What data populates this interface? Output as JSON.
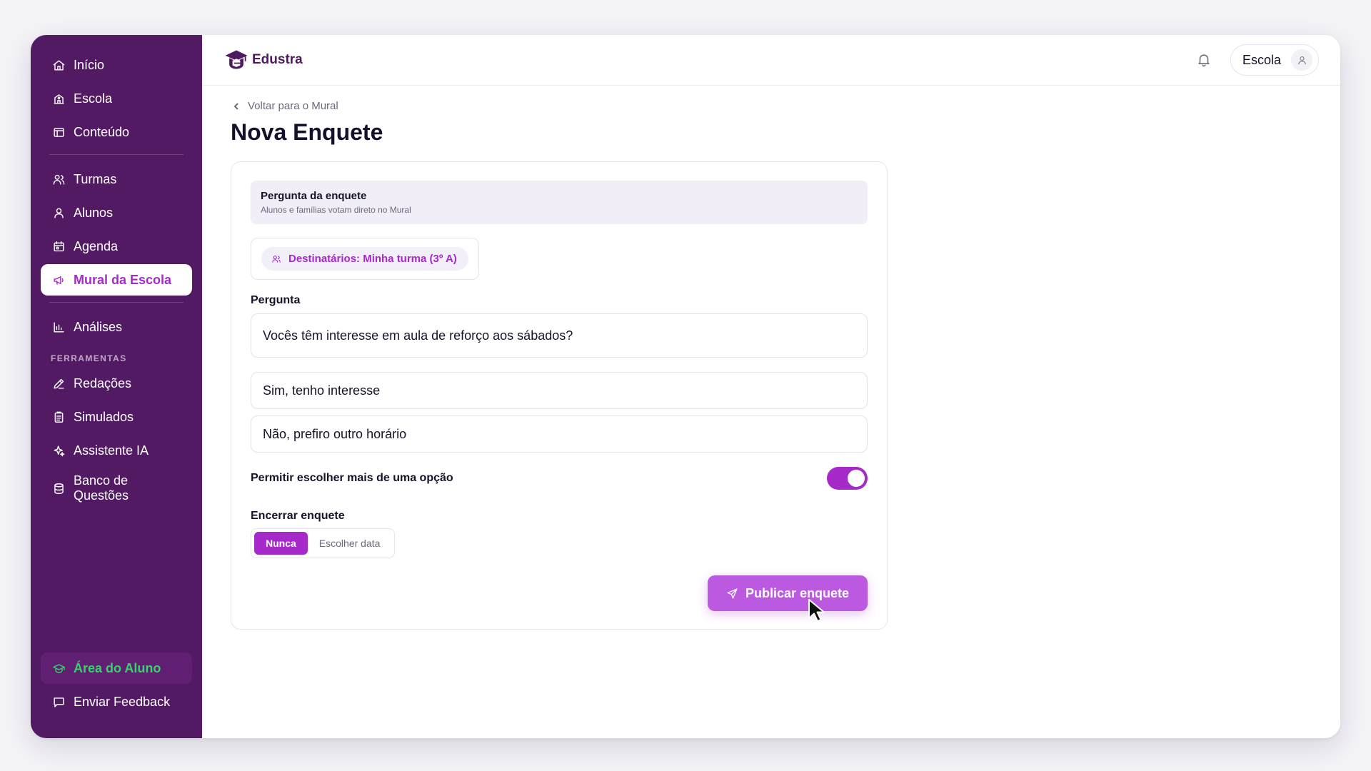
{
  "sidebar": {
    "items": [
      {
        "label": "Início",
        "icon": "home-icon"
      },
      {
        "label": "Escola",
        "icon": "school-icon"
      },
      {
        "label": "Conteúdo",
        "icon": "content-icon"
      },
      {
        "label": "Turmas",
        "icon": "users-icon"
      },
      {
        "label": "Alunos",
        "icon": "user-icon"
      },
      {
        "label": "Agenda",
        "icon": "calendar-icon"
      },
      {
        "label": "Mural da Escola",
        "icon": "megaphone-icon",
        "active": true
      },
      {
        "label": "Análises",
        "icon": "bar-chart-icon"
      }
    ],
    "tools_label": "FERRAMENTAS",
    "tools": [
      {
        "label": "Redações",
        "icon": "pen-icon"
      },
      {
        "label": "Simulados",
        "icon": "clipboard-icon"
      },
      {
        "label": "Assistente IA",
        "icon": "sparkles-icon"
      },
      {
        "label": "Banco de Questões",
        "icon": "database-icon"
      }
    ],
    "bottom": [
      {
        "label": "Área do Aluno",
        "icon": "graduation-cap-icon"
      },
      {
        "label": "Enviar Feedback",
        "icon": "message-icon"
      }
    ]
  },
  "header": {
    "brand": "Edustra",
    "user_label": "Escola"
  },
  "page": {
    "back_label": "Voltar para o Mural",
    "title": "Nova Enquete"
  },
  "form": {
    "section_title": "Pergunta da enquete",
    "section_subtitle": "Alunos e famílias votam direto no Mural",
    "recipients": "Destinatários: Minha turma (3º A)",
    "question_label": "Pergunta",
    "question_value": "Vocês têm interesse em aula de reforço aos sábados?",
    "options": [
      "Sim, tenho interesse",
      "Não, prefiro outro horário"
    ],
    "multi_label": "Permitir escolher mais de uma opção",
    "multi_enabled": true,
    "end_label": "Encerrar enquete",
    "end_options": [
      "Nunca",
      "Escolher data"
    ],
    "end_selected": "Nunca",
    "publish_label": "Publicar enquete"
  },
  "colors": {
    "sidebar": "#521a63",
    "accent": "#a52ac9",
    "publish": "#bb59e0",
    "student": "#36d36a"
  }
}
